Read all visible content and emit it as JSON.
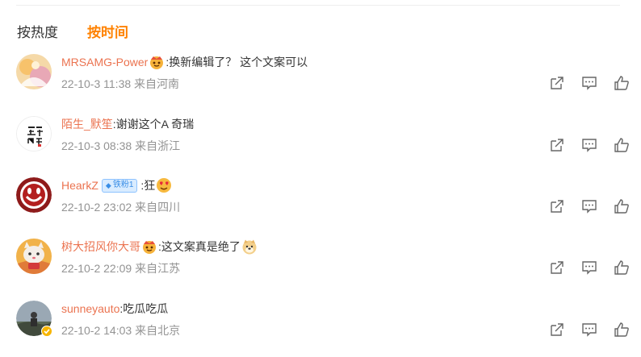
{
  "sort_tabs": {
    "by_heat": "按热度",
    "by_time": "按时间"
  },
  "comments": [
    {
      "username": "MRSAMG-Power",
      "text": ":换新编辑了？ 这个文案可以",
      "time": "22-10-3 11:38",
      "location": "来自河南",
      "badge_icon": "vip-crown-emoji-icon"
    },
    {
      "username": "陌生_默笙",
      "text": ":谢谢这个A 奇瑞",
      "time": "22-10-3 08:38",
      "location": "来自浙江",
      "avatar_text": "拿一门格"
    },
    {
      "username": "HearkZ",
      "fan_badge": "铁粉1",
      "text": ":狂",
      "time": "22-10-2 23:02",
      "location": "来自四川",
      "badge_icon": "heart-eyes-emoji-icon"
    },
    {
      "username": "树大招风你大哥",
      "text": ":这文案真是绝了",
      "time": "22-10-2 22:09",
      "location": "来自江苏",
      "badge_icon": "vip-crown-emoji-icon"
    },
    {
      "username": "sunneyauto",
      "text": ":吃瓜吃瓜",
      "time": "22-10-2 14:03",
      "location": "来自北京",
      "badge_icon": "verified-gold-icon"
    }
  ],
  "colors": {
    "active_tab": "#ff8200",
    "username": "#eb7350",
    "meta": "#939393"
  }
}
